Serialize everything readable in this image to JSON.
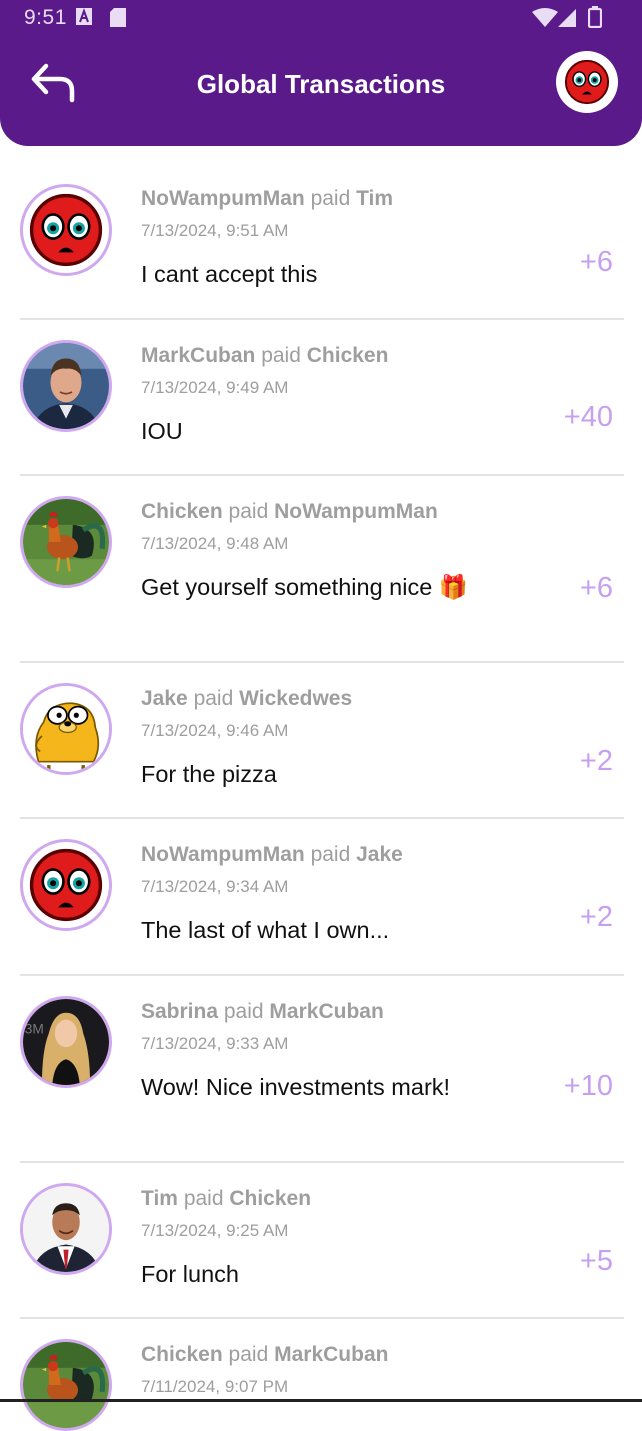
{
  "status": {
    "time": "9:51"
  },
  "header": {
    "title": "Global Transactions"
  },
  "connector": "paid",
  "transactions": [
    {
      "from": "NoWampumMan",
      "to": "Tim",
      "date": "7/13/2024, 9:51 AM",
      "message": "I cant accept this",
      "amount": "+6",
      "avatar": "sad-face-avatar"
    },
    {
      "from": "MarkCuban",
      "to": "Chicken",
      "date": "7/13/2024, 9:49 AM",
      "message": "IOU",
      "amount": "+40",
      "avatar": "man-photo-avatar"
    },
    {
      "from": "Chicken",
      "to": "NoWampumMan",
      "date": "7/13/2024, 9:48 AM",
      "message": "Get yourself something nice 🎁",
      "amount": "+6",
      "avatar": "rooster-avatar"
    },
    {
      "from": "Jake",
      "to": "Wickedwes",
      "date": "7/13/2024, 9:46 AM",
      "message": "For the pizza",
      "amount": "+2",
      "avatar": "cartoon-dog-avatar"
    },
    {
      "from": "NoWampumMan",
      "to": "Jake",
      "date": "7/13/2024, 9:34 AM",
      "message": "The last of what I own...",
      "amount": "+2",
      "avatar": "sad-face-avatar"
    },
    {
      "from": "Sabrina",
      "to": "MarkCuban",
      "date": "7/13/2024, 9:33 AM",
      "message": "Wow! Nice investments mark!",
      "amount": "+10",
      "avatar": "woman-photo-avatar"
    },
    {
      "from": "Tim",
      "to": "Chicken",
      "date": "7/13/2024, 9:25 AM",
      "message": "For lunch",
      "amount": "+5",
      "avatar": "man-suit-avatar"
    },
    {
      "from": "Chicken",
      "to": "MarkCuban",
      "date": "7/11/2024, 9:07 PM",
      "message": "",
      "amount": "",
      "avatar": "rooster-avatar"
    }
  ]
}
